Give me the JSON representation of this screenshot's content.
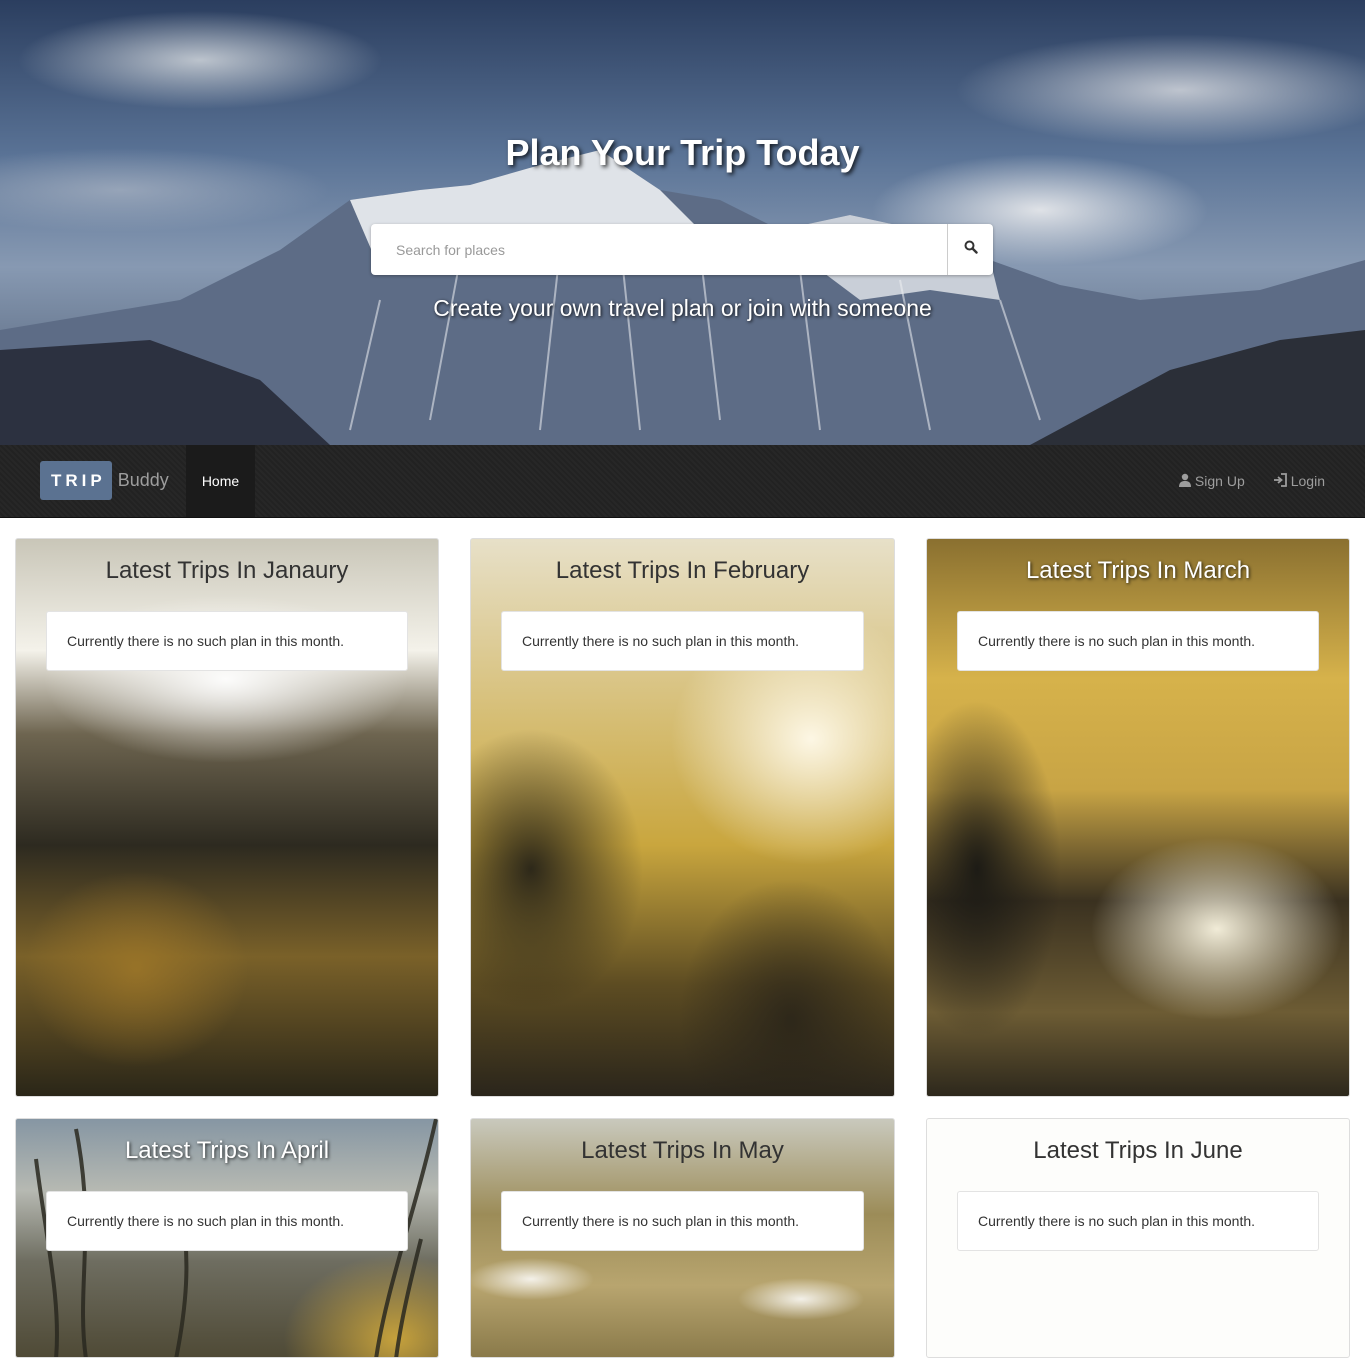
{
  "hero": {
    "title": "Plan Your Trip Today",
    "search_placeholder": "Search for places",
    "subtitle": "Create your own travel plan or join with someone"
  },
  "navbar": {
    "brand_trip": "TRIP",
    "brand_buddy": "Buddy",
    "home": "Home",
    "signup": "Sign Up",
    "login": "Login"
  },
  "cards": [
    {
      "title": "Latest Trips In Janaury",
      "message": "Currently there is no such plan in this month."
    },
    {
      "title": "Latest Trips In February",
      "message": "Currently there is no such plan in this month."
    },
    {
      "title": "Latest Trips In March",
      "message": "Currently there is no such plan in this month."
    },
    {
      "title": "Latest Trips In April",
      "message": "Currently there is no such plan in this month."
    },
    {
      "title": "Latest Trips In May",
      "message": "Currently there is no such plan in this month."
    },
    {
      "title": "Latest Trips In June",
      "message": "Currently there is no such plan in this month."
    }
  ],
  "icons": {
    "search": "search-icon",
    "signup": "user-icon",
    "login": "login-icon"
  },
  "colors": {
    "navbar_bg": "#222222",
    "brand_accent": "#5b7291",
    "nav_link": "#9d9d9d"
  }
}
